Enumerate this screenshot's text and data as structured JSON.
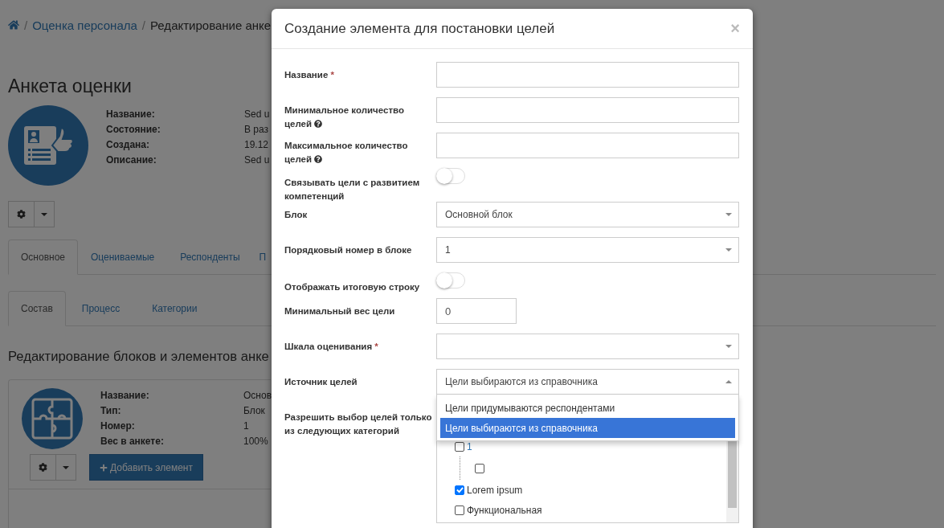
{
  "breadcrumb": [
    {
      "label": "Оценка персонала",
      "kind": "link"
    },
    {
      "label": "Редактирование анке",
      "kind": "current"
    }
  ],
  "separator": "/",
  "page_title": "Анкета оценки",
  "summary": [
    {
      "label": "Название:",
      "value": "Sed u"
    },
    {
      "label": "Состояние:",
      "value": "В раз"
    },
    {
      "label": "Создана:",
      "value": "19.12"
    },
    {
      "label": "Описание:",
      "value": "Sed u"
    }
  ],
  "tabs": [
    {
      "label": "Основное",
      "selected": true
    },
    {
      "label": "Оцениваемые",
      "selected": false
    },
    {
      "label": "Респонденты",
      "selected": false
    },
    {
      "label": "П",
      "selected": false
    }
  ],
  "subtabs": [
    {
      "label": "Состав",
      "selected": true
    },
    {
      "label": "Процесс",
      "selected": false
    },
    {
      "label": "Категории",
      "selected": false
    }
  ],
  "section_title": "Редактирование блоков и элементов анке",
  "block": {
    "fields": [
      {
        "label": "Название:",
        "value": "Основ"
      },
      {
        "label": "Тип:",
        "value": "Блок"
      },
      {
        "label": "Номер:",
        "value": "1"
      },
      {
        "label": "Вес в анкете:",
        "value": "100%"
      }
    ],
    "add_button": "Добавить элемент"
  },
  "modal": {
    "title": "Создание элемента для постановки целей",
    "close": "×",
    "fields": [
      {
        "kind": "text",
        "label": "Название",
        "required_mark": "*"
      },
      {
        "kind": "text",
        "label": "Минимальное количество целей",
        "help": true
      },
      {
        "kind": "text",
        "label": "Максимальное количество целей",
        "help": true
      },
      {
        "kind": "toggle",
        "label": "Связывать цели с развитием компетенций",
        "on": false
      },
      {
        "kind": "select",
        "label": "Блок",
        "value": "Основной блок",
        "expanded": false
      },
      {
        "kind": "select",
        "label": "Порядковый номер в блоке",
        "value": "1",
        "expanded": false
      },
      {
        "kind": "toggle",
        "label": "Отображать итоговую строку",
        "on": false
      },
      {
        "kind": "number",
        "label": "Минимальный вес цели",
        "value": "0"
      },
      {
        "kind": "select",
        "label": "Шкала оценивания",
        "required_mark": "*",
        "expanded": false
      },
      {
        "kind": "select",
        "label": "Источник целей",
        "value": "Цели выбираются из справочника",
        "expanded": true,
        "options": [
          {
            "label": "Цели придумываются респондентами",
            "selected": false
          },
          {
            "label": "Цели выбираются из справочника",
            "selected": true
          }
        ]
      },
      {
        "kind": "tree",
        "label": "Разрешить выбор целей только из следующих категорий",
        "items": [
          {
            "label": "1",
            "checked": false,
            "children": [
              {
                "checked": false
              }
            ]
          },
          {
            "label": "Lorem ipsum",
            "checked": true
          },
          {
            "label": "Функциональная",
            "checked": false
          }
        ]
      }
    ]
  }
}
